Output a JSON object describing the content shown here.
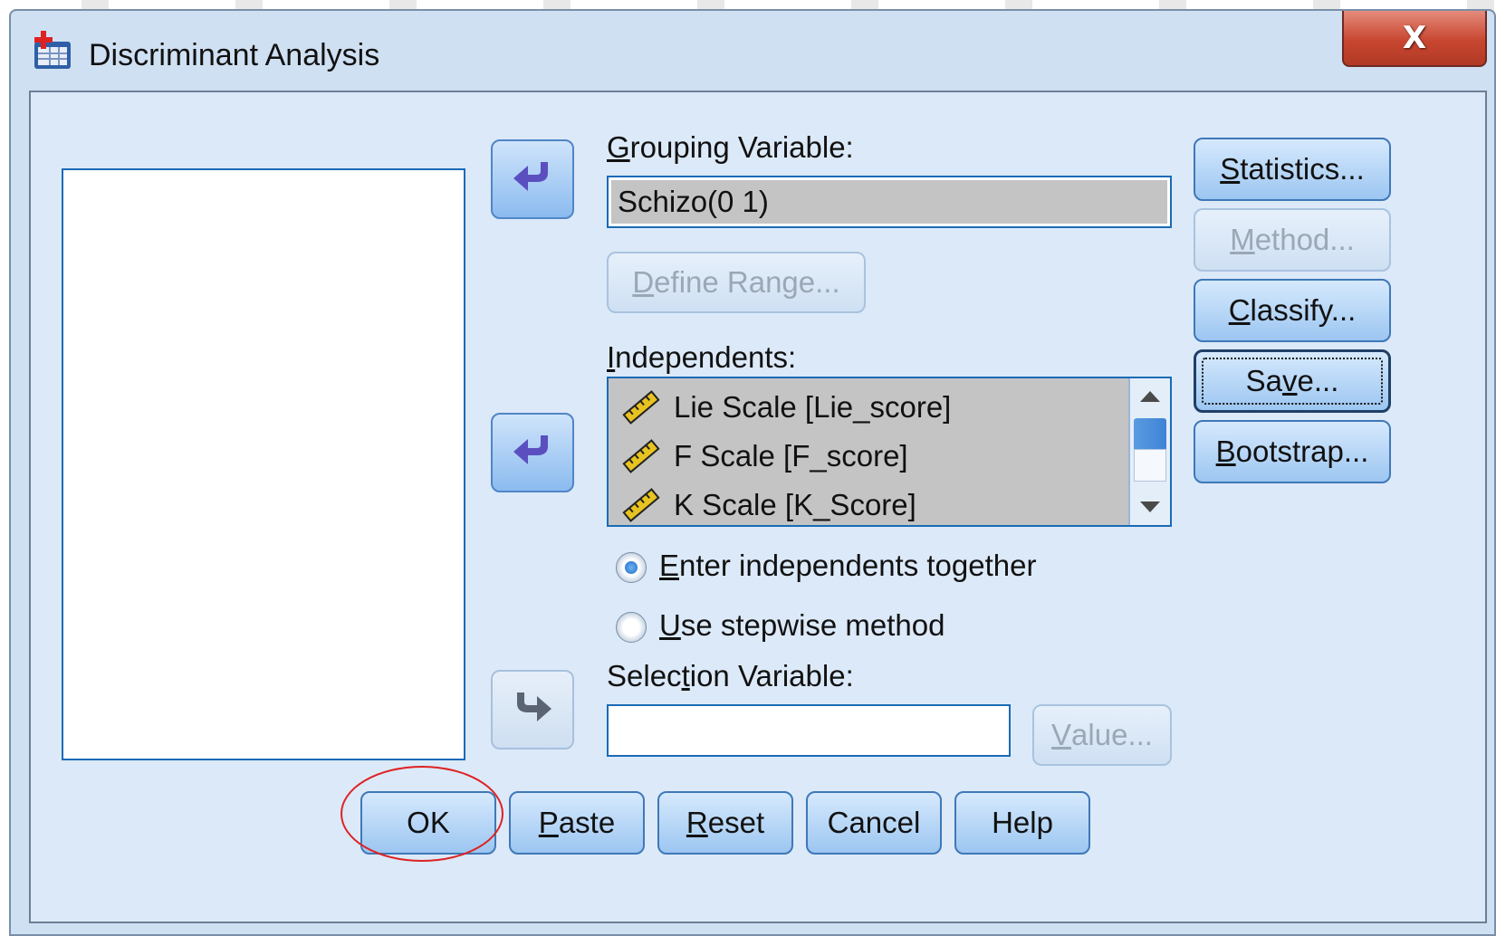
{
  "window": {
    "title": "Discriminant Analysis",
    "close_label": "X"
  },
  "grouping": {
    "label_pre": "",
    "label_accel": "G",
    "label_post": "rouping Variable:",
    "value": "Schizo(0 1)",
    "define_range_pre": "",
    "define_range_accel": "D",
    "define_range_post": "efine Range..."
  },
  "independents": {
    "label_pre": "",
    "label_accel": "I",
    "label_post": "ndependents:",
    "items": [
      "Lie Scale [Lie_score]",
      "F Scale [F_score]",
      "K Scale [K_Score]"
    ]
  },
  "method": {
    "enter_accel": "E",
    "enter_post": "nter independents together",
    "stepwise_accel": "U",
    "stepwise_post": "se stepwise method",
    "selected": "enter"
  },
  "selection": {
    "label_pre": "Selec",
    "label_accel": "t",
    "label_post": "ion Variable:",
    "value": "",
    "value_btn_pre": "",
    "value_btn_accel": "V",
    "value_btn_post": "alue..."
  },
  "side_buttons": [
    {
      "pre": "",
      "accel": "S",
      "post": "tatistics...",
      "enabled": true
    },
    {
      "pre": "",
      "accel": "M",
      "post": "ethod...",
      "enabled": false
    },
    {
      "pre": "",
      "accel": "C",
      "post": "lassify...",
      "enabled": true
    },
    {
      "pre": "Sa",
      "accel": "v",
      "post": "e...",
      "enabled": true
    },
    {
      "pre": "",
      "accel": "B",
      "post": "ootstrap...",
      "enabled": true
    }
  ],
  "bottom_buttons": [
    {
      "pre": "OK",
      "accel": "",
      "post": ""
    },
    {
      "pre": "",
      "accel": "P",
      "post": "aste"
    },
    {
      "pre": "",
      "accel": "R",
      "post": "eset"
    },
    {
      "pre": "Cancel",
      "accel": "",
      "post": ""
    },
    {
      "pre": "Help",
      "accel": "",
      "post": ""
    }
  ],
  "colors": {
    "dialog_bg": "#dce9f8",
    "button_border": "#3f78b8",
    "highlight_circle": "#dd2222",
    "close_red": "#c84630"
  },
  "icons": [
    "app-icon",
    "close-icon",
    "move-left-arrow-icon",
    "move-right-arrow-icon",
    "scale-ruler-icon",
    "scroll-up-icon",
    "scroll-down-icon"
  ]
}
